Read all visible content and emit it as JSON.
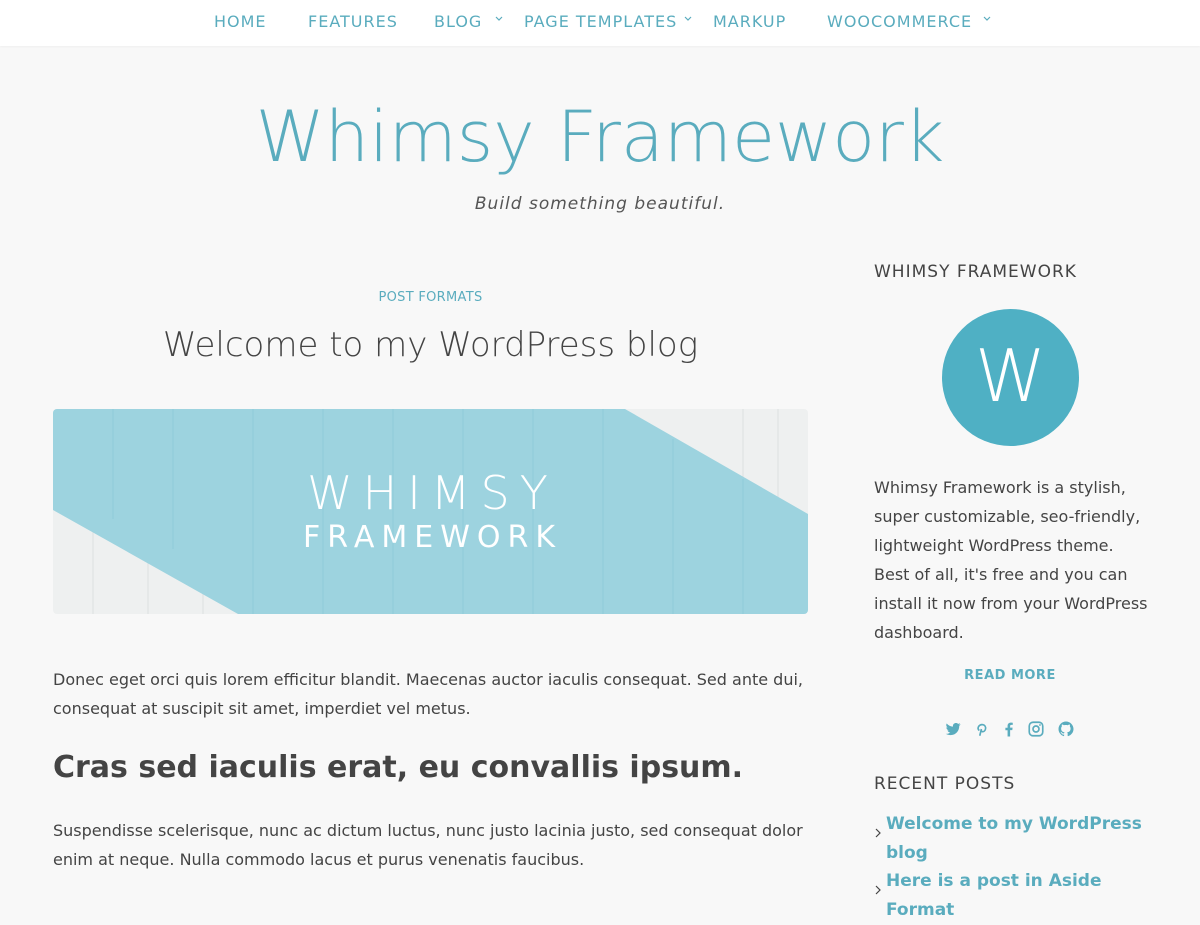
{
  "nav": {
    "items": [
      {
        "label": "HOME"
      },
      {
        "label": "FEATURES"
      },
      {
        "label": "BLOG"
      },
      {
        "label": "PAGE TEMPLATES"
      },
      {
        "label": "MARKUP"
      },
      {
        "label": "WOOCOMMERCE"
      }
    ]
  },
  "header": {
    "title": "Whimsy Framework",
    "tagline": "Build something beautiful."
  },
  "post": {
    "category": "POST FORMATS",
    "title": "Welcome to my WordPress blog",
    "featured_image": {
      "line1": "WHIMSY",
      "line2": "FRAMEWORK"
    },
    "para1": "Donec eget orci quis lorem efficitur blandit. Maecenas auctor iaculis consequat. Sed ante dui, consequat at suscipit sit amet, imperdiet vel metus.",
    "subheading": "Cras sed iaculis erat, eu convallis ipsum.",
    "para2": "Suspendisse scelerisque, nunc ac dictum luctus, nunc justo lacinia justo, sed consequat dolor enim at neque. Nulla commodo lacus et purus venenatis faucibus."
  },
  "sidebar": {
    "about": {
      "title": "WHIMSY FRAMEWORK",
      "logo_letter": "W",
      "text": "Whimsy Framework is a stylish, super customizable, seo-friendly, lightweight WordPress theme. Best of all, it's free and you can install it now from your WordPress dashboard.",
      "read_more": "READ MORE"
    },
    "social": [
      "twitter-icon",
      "pinterest-icon",
      "facebook-icon",
      "instagram-icon",
      "github-icon"
    ],
    "recent": {
      "title": "RECENT POSTS",
      "items": [
        {
          "label": "Welcome to my WordPress blog"
        },
        {
          "label": "Here is a post in Aside Format"
        }
      ]
    }
  },
  "colors": {
    "accent": "#5aacbe",
    "background": "#f8f8f8",
    "text": "#444444",
    "banner": "#9dd3df"
  }
}
